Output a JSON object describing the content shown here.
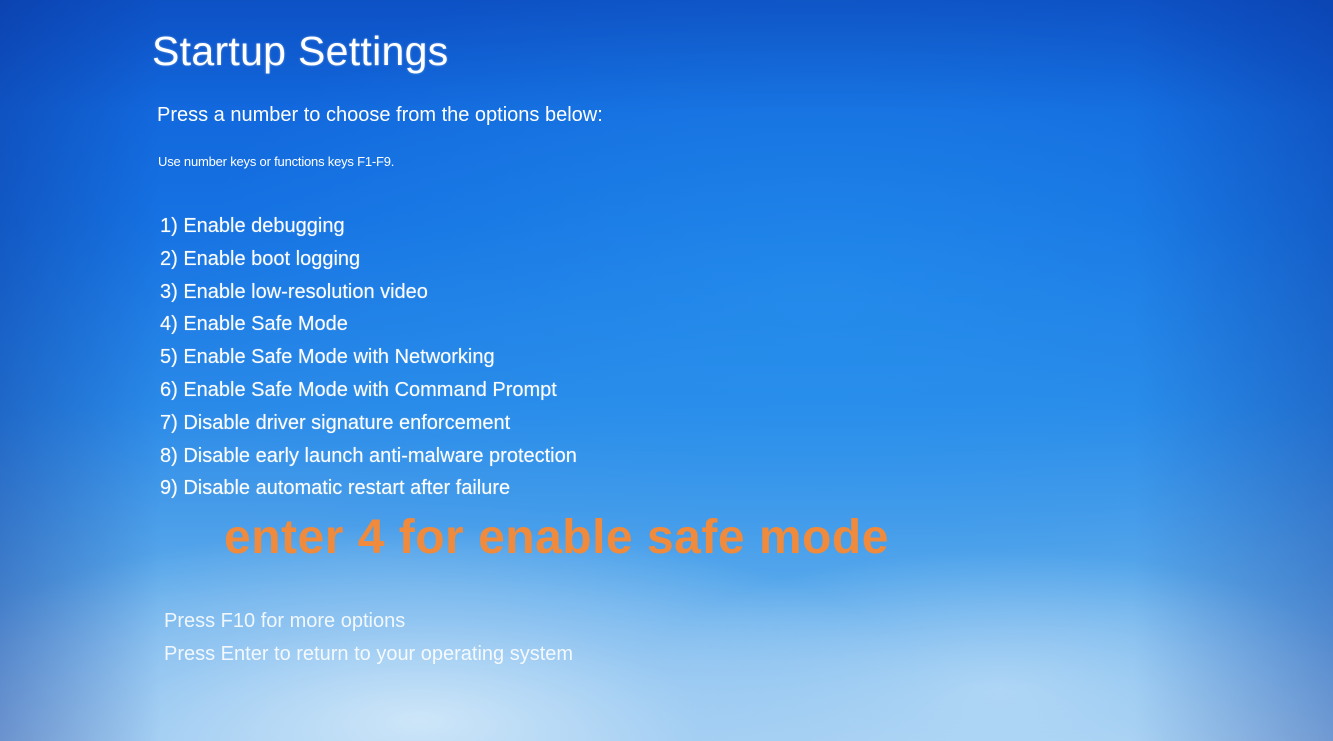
{
  "screen": {
    "title": "Startup Settings",
    "instruction": "Press a number to choose from the options below:",
    "hint": "Use number keys or functions keys F1-F9."
  },
  "options": [
    "1) Enable debugging",
    "2) Enable boot logging",
    "3) Enable low-resolution video",
    "4) Enable Safe Mode",
    "5) Enable Safe Mode with Networking",
    "6) Enable Safe Mode with Command Prompt",
    "7) Disable driver signature enforcement",
    "8) Disable early launch anti-malware protection",
    "9) Disable automatic restart after failure"
  ],
  "annotation": {
    "text": "enter 4 for enable safe mode",
    "color": "#f08a3c"
  },
  "footer": {
    "more_options": "Press F10 for more options",
    "return": "Press Enter to return to your operating system"
  },
  "colors": {
    "background": "#1672e2",
    "text": "#ffffff"
  }
}
